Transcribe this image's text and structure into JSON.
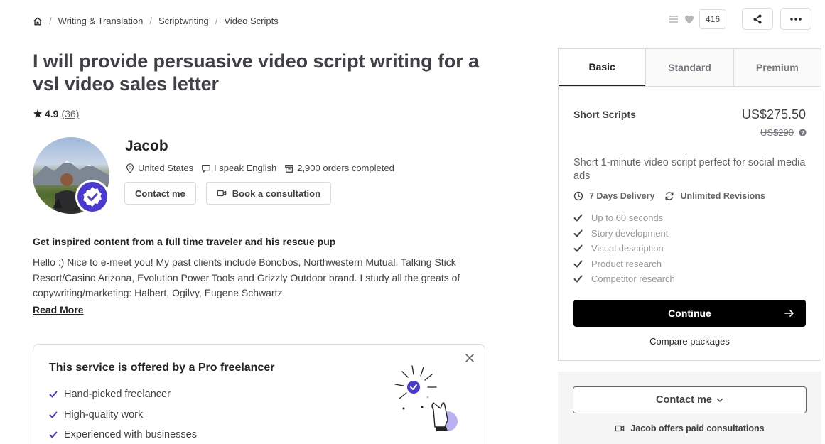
{
  "breadcrumb": {
    "items": [
      "Writing & Translation",
      "Scriptwriting",
      "Video Scripts"
    ]
  },
  "actions": {
    "likes_count": "416"
  },
  "gig": {
    "title": "I will provide persuasive video script writing for a vsl video sales letter",
    "rating": "4.9",
    "review_count": "(36)"
  },
  "seller": {
    "name": "Jacob",
    "country": "United States",
    "language": "I speak English",
    "orders": "2,900 orders completed",
    "contact_label": "Contact me",
    "consult_label": "Book a consultation"
  },
  "about": {
    "heading": "Get inspired content from a full time traveler and his rescue pup",
    "text": "Hello :) Nice to e-meet you! My past clients include Bonobos, Northwestern Mutual, Talking Stick Resort/Casino Arizona, Evolution Power Tools and Grizzly Outdoor brand. I study all the greats of copywriting/marketing: Halbert, Ogilvy, Eugene Schwartz.",
    "read_more": "Read More"
  },
  "pro_card": {
    "title": "This service is offered by a Pro freelancer",
    "items": [
      "Hand-picked freelancer",
      "High-quality work",
      "Experienced with businesses"
    ]
  },
  "packages": {
    "tabs": [
      "Basic",
      "Standard",
      "Premium"
    ],
    "active_tab": "Basic",
    "name": "Short Scripts",
    "price": "US$275.50",
    "old_price": "US$290",
    "description": "Short 1-minute video script perfect for social media ads",
    "delivery": "7 Days Delivery",
    "revisions": "Unlimited Revisions",
    "features": [
      "Up to 60 seconds",
      "Story development",
      "Visual description",
      "Product research",
      "Competitor research"
    ],
    "continue_label": "Continue",
    "compare_label": "Compare packages"
  },
  "contact_panel": {
    "button_label": "Contact me",
    "consult_note": "Jacob offers paid consultations"
  },
  "colors": {
    "badge": "#4a3ad1",
    "primary_button": "#000000",
    "text_dark": "#404145",
    "text_muted": "#95979d"
  }
}
